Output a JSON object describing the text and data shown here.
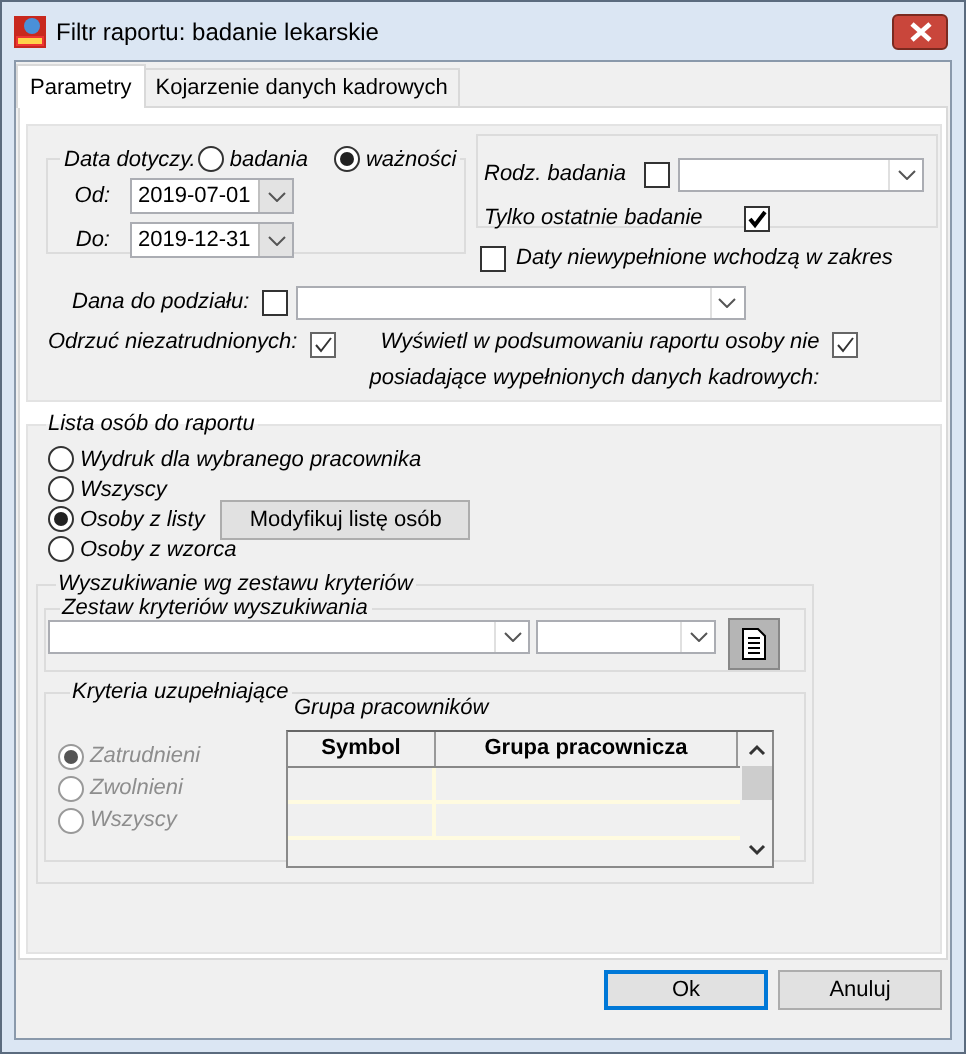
{
  "window": {
    "title": "Filtr raportu: badanie lekarskie"
  },
  "tabs": [
    {
      "label": "Parametry",
      "selected": true
    },
    {
      "label": "Kojarzenie danych kadrowych",
      "selected": false
    }
  ],
  "date_group": {
    "legend": "Data dotyczy.",
    "options": [
      {
        "label": "badania",
        "selected": false
      },
      {
        "label": "ważności",
        "selected": true
      }
    ],
    "from": {
      "label": "Od:",
      "value": "2019-07-01"
    },
    "to": {
      "label": "Do:",
      "value": "2019-12-31"
    }
  },
  "exam_type": {
    "label": "Rodz. badania",
    "checked": false
  },
  "last_exam_only": {
    "label": "Tylko ostatnie badanie",
    "checked": true
  },
  "empty_dates_in_range": {
    "label": "Daty niewypełnione wchodzą w zakres",
    "checked": false
  },
  "split_field": {
    "label": "Dana do podziału:",
    "checked": false
  },
  "reject_unemployed": {
    "label": "Odrzuć niezatrudnionych:",
    "checked": true
  },
  "show_missing": {
    "label": "Wyświetl w podsumowaniu raportu osoby nie posiadające wypełnionych danych kadrowych:",
    "checked": true
  },
  "person_list": {
    "legend": "Lista osób do raportu",
    "options": [
      {
        "label": "Wydruk dla wybranego pracownika",
        "selected": false
      },
      {
        "label": "Wszyscy",
        "selected": false
      },
      {
        "label": "Osoby z listy",
        "selected": true
      },
      {
        "label": "Osoby z wzorca",
        "selected": false
      }
    ],
    "modify_button": "Modyfikuj listę osób"
  },
  "criteria_search": {
    "legend": "Wyszukiwanie wg zestawu kryteriów",
    "set_legend": "Zestaw kryteriów wyszukiwania"
  },
  "supplementary": {
    "legend": "Kryteria uzupełniające",
    "disabled": true,
    "options": [
      {
        "label": "Zatrudnieni",
        "selected": true
      },
      {
        "label": "Zwolnieni",
        "selected": false
      },
      {
        "label": "Wszyscy",
        "selected": false
      }
    ],
    "group_label": "Grupa pracowników",
    "columns": [
      "Symbol",
      "Grupa pracownicza"
    ]
  },
  "buttons": [
    {
      "label": "Ok",
      "focused": true
    },
    {
      "label": "Anuluj",
      "focused": false
    }
  ]
}
